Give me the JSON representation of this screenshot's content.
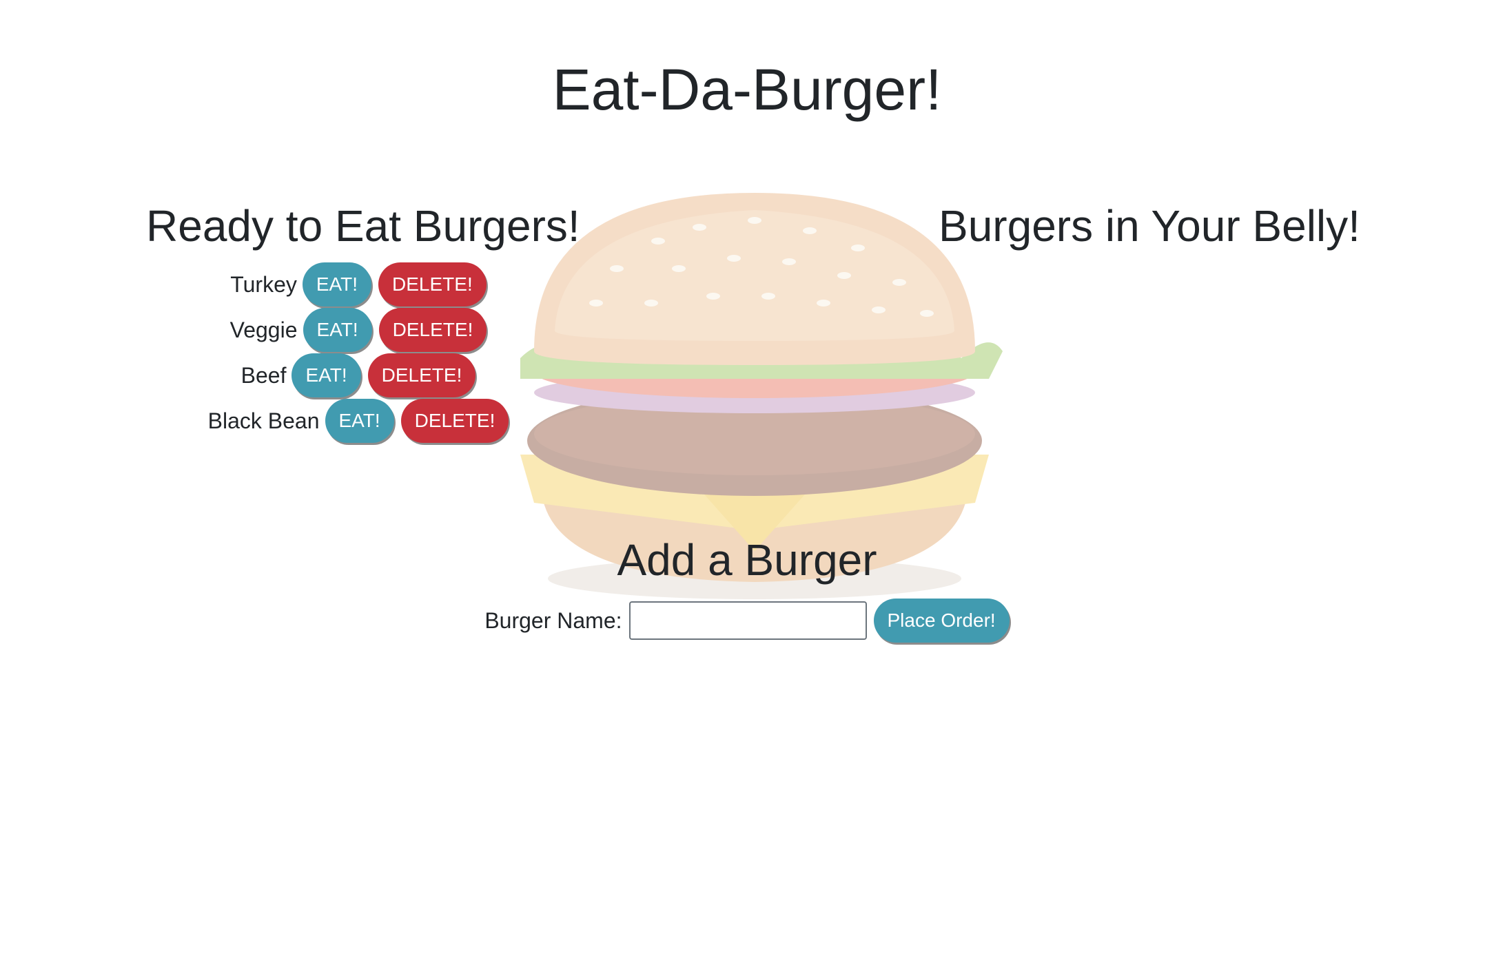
{
  "header": {
    "title": "Eat-Da-Burger!"
  },
  "ready": {
    "title": "Ready to Eat Burgers!",
    "eat_label": "EAT!",
    "delete_label": "DELETE!",
    "items": [
      {
        "name": "Turkey"
      },
      {
        "name": "Veggie"
      },
      {
        "name": "Beef"
      },
      {
        "name": "Black Bean"
      }
    ]
  },
  "devoured": {
    "title": "Burgers in Your Belly!",
    "items": []
  },
  "add_form": {
    "title": "Add a Burger",
    "name_label": "Burger Name:",
    "name_value": "",
    "submit_label": "Place Order!"
  },
  "colors": {
    "eat_button": "#419bb0",
    "delete_button": "#c8303a",
    "text": "#212529"
  },
  "background_image": "burger-illustration"
}
